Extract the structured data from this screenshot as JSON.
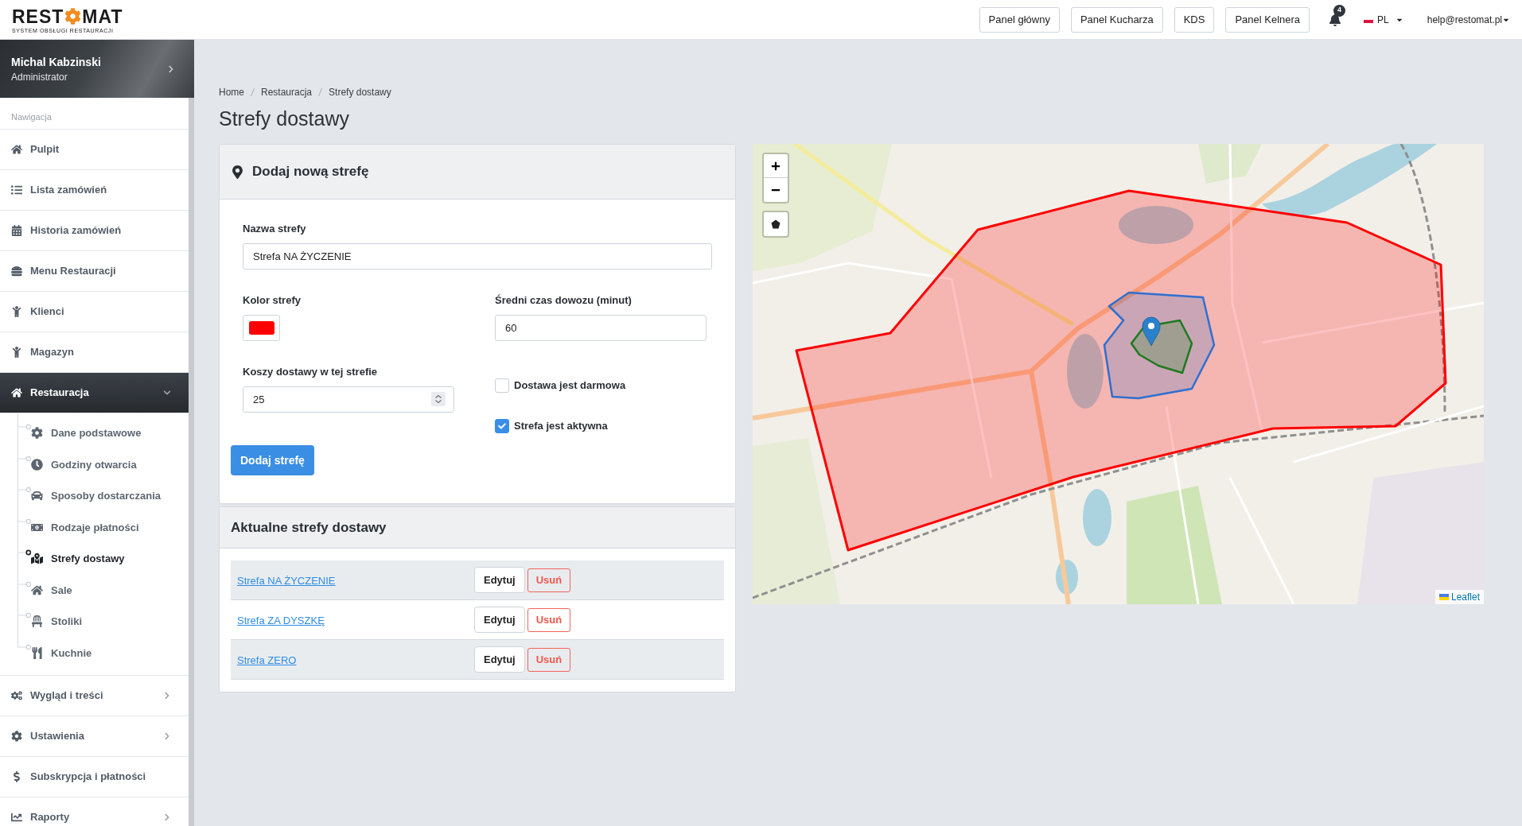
{
  "header": {
    "logo": {
      "left": "REST",
      "right": "MAT",
      "tagline": "SYSTEM OBSŁUGI RESTAURACJI"
    },
    "panels": [
      "Panel główny",
      "Panel Kucharza",
      "KDS",
      "Panel Kelnera"
    ],
    "notifications": "4",
    "language": "PL",
    "account": "help@restomat.pl"
  },
  "sidebar": {
    "user": {
      "name": "Michal Kabzinski",
      "role": "Administrator"
    },
    "section": "Nawigacja",
    "items": [
      {
        "label": "Pulpit",
        "kind": "link",
        "selected": false
      },
      {
        "label": "Lista zamówień",
        "kind": "link",
        "selected": false
      },
      {
        "label": "Historia zamówień",
        "kind": "link",
        "selected": false
      },
      {
        "label": "Menu Restauracji",
        "kind": "link",
        "selected": false
      },
      {
        "label": "Klienci",
        "kind": "link",
        "selected": false
      },
      {
        "label": "Magazyn",
        "kind": "link",
        "selected": false
      },
      {
        "label": "Restauracja",
        "kind": "group",
        "selected": true,
        "expanded": true,
        "children": [
          {
            "label": "Dane podstawowe",
            "selected": false
          },
          {
            "label": "Godziny otwarcia",
            "selected": false
          },
          {
            "label": "Sposoby dostarczania",
            "selected": false
          },
          {
            "label": "Rodzaje płatności",
            "selected": false
          },
          {
            "label": "Strefy dostawy",
            "selected": true
          },
          {
            "label": "Sale",
            "selected": false
          },
          {
            "label": "Stoliki",
            "selected": false
          },
          {
            "label": "Kuchnie",
            "selected": false
          }
        ]
      },
      {
        "label": "Wygląd i treści",
        "kind": "group",
        "selected": false,
        "expanded": false
      },
      {
        "label": "Ustawienia",
        "kind": "group",
        "selected": false,
        "expanded": false
      },
      {
        "label": "Subskrypcja i płatności",
        "kind": "link",
        "selected": false
      },
      {
        "label": "Raporty",
        "kind": "group",
        "selected": false,
        "expanded": false
      }
    ]
  },
  "breadcrumb": [
    "Home",
    "Restauracja",
    "Strefy dostawy"
  ],
  "title": "Strefy dostawy",
  "add_zone": {
    "title": "Dodaj nową strefę",
    "name": {
      "label": "Nazwa strefy",
      "value": "Strefa NA ŻYCZENIE"
    },
    "color": {
      "label": "Kolor strefy",
      "color": "#ff0000"
    },
    "time": {
      "label": "Średni czas dowozu (minut)",
      "value": "60"
    },
    "cost": {
      "label": "Koszy dostawy w tej strefie",
      "value": "25"
    },
    "options": [
      {
        "label": "Dostawa jest darmowa",
        "checked": false
      },
      {
        "label": "Strefa jest aktywna",
        "checked": true
      }
    ],
    "submit": "Dodaj strefę"
  },
  "zones": {
    "title": "Aktualne strefy dostawy",
    "rows": [
      {
        "name": "Strefa NA ŻYCZENIE",
        "edit": "Edytuj",
        "delete": "Usuń"
      },
      {
        "name": "Strefa ZA DYSZKĘ",
        "edit": "Edytuj",
        "delete": "Usuń"
      },
      {
        "name": "Strefa ZERO",
        "edit": "Edytuj",
        "delete": "Usuń"
      }
    ]
  },
  "map": {
    "attribution": "Leaflet"
  }
}
